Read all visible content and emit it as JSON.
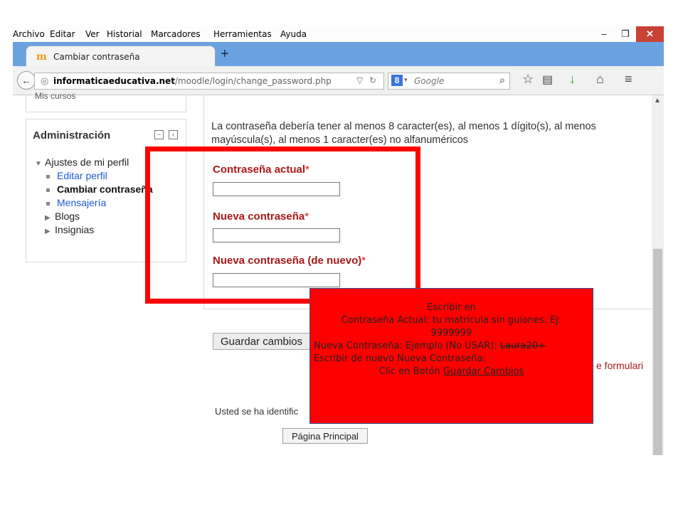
{
  "menu": [
    "Archivo",
    "Editar",
    "Ver",
    "Historial",
    "Marcadores",
    "Herramientas",
    "Ayuda"
  ],
  "window_controls": {
    "minimize": "–",
    "maximize": "❐",
    "close": "✕"
  },
  "tab": {
    "title": "Cambiar contraseña",
    "new_tab": "+"
  },
  "address": {
    "host": "informaticaeducativa.net",
    "path": "/moodle/login/change_password.php",
    "search_engine": "8",
    "search_placeholder": "Google"
  },
  "sidebar": {
    "top_block_partial": "Mis cursos",
    "admin_title": "Administración",
    "tree": {
      "root": "Ajustes de mi perfil",
      "items": [
        "Editar perfil",
        "Cambiar contraseña",
        "Mensajería",
        "Blogs",
        "Insignias"
      ]
    }
  },
  "main": {
    "rule_line1": "La contraseña debería tener al menos 8 caracter(es), al menos 1 dígito(s), al menos",
    "rule_line2": "mayúscula(s), al menos 1 caracter(es) no alfanuméricos",
    "fields": [
      {
        "label": "Contraseña actual",
        "required": "*"
      },
      {
        "label": "Nueva contraseña",
        "required": "*"
      },
      {
        "label": "Nueva contraseña (de nuevo)",
        "required": "*"
      }
    ],
    "save_button": "Guardar cambios",
    "form_note_tail": "e formulari",
    "identified_text": "Usted se ha identific",
    "home_button": "Página Principal"
  },
  "annotation": {
    "line1": "Escribir en",
    "line2": "Contraseña Actual:  tu matrícula sin guiones. Ej:",
    "line3": "9999999",
    "line4_prefix": "Nueva Contraseña:  Ejemplo (No USAR): ",
    "line4_struck": "Laura20+",
    "line5": "Escribir de nuevo Nueva Contraseña:",
    "line6_prefix": "Clic en Botón ",
    "line6_link": "Guardar Cambios"
  },
  "colors": {
    "annotation_fill": "#ff0000",
    "frame": "#ff0000",
    "tabstrip": "#6ba3e0",
    "label_red": "#aa1818",
    "link_blue": "#1a5cd6"
  }
}
